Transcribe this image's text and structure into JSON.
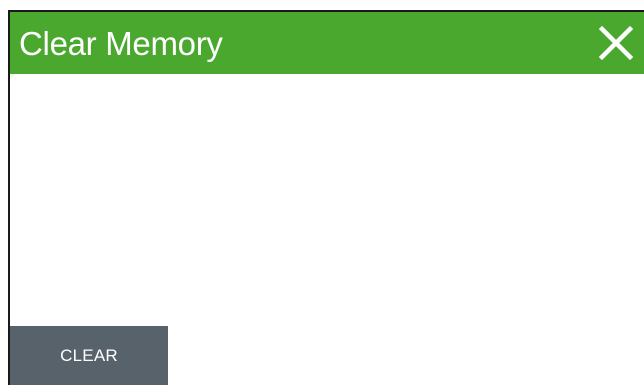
{
  "dialog": {
    "title": "Clear Memory",
    "close_icon": "close-icon",
    "clear_button_label": "CLEAR"
  },
  "colors": {
    "titlebar": "#4aa82f",
    "button": "#58626b",
    "text_on_dark": "#ffffff"
  }
}
